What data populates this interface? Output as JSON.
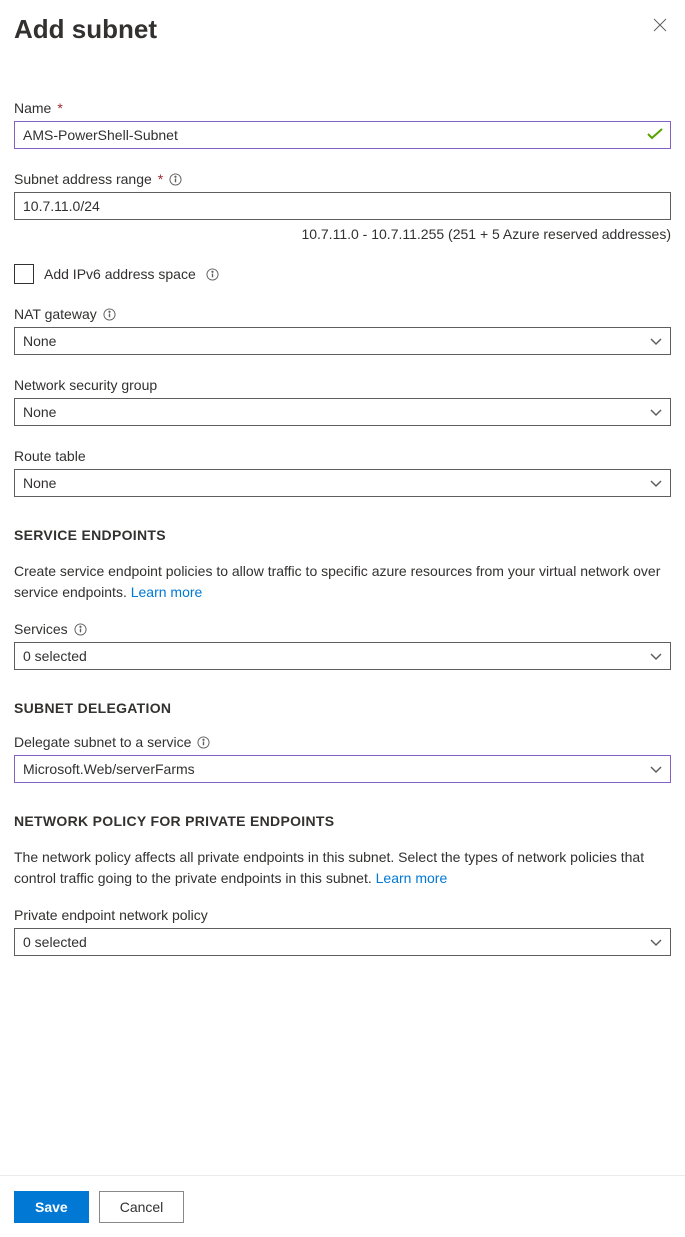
{
  "header": {
    "title": "Add subnet"
  },
  "fields": {
    "name": {
      "label": "Name",
      "value": "AMS-PowerShell-Subnet"
    },
    "address_range": {
      "label": "Subnet address range",
      "value": "10.7.11.0/24",
      "hint": "10.7.11.0 - 10.7.11.255 (251 + 5 Azure reserved addresses)"
    },
    "ipv6_checkbox": {
      "label": "Add IPv6 address space",
      "checked": false
    },
    "nat_gateway": {
      "label": "NAT gateway",
      "value": "None"
    },
    "nsg": {
      "label": "Network security group",
      "value": "None"
    },
    "route_table": {
      "label": "Route table",
      "value": "None"
    }
  },
  "service_endpoints": {
    "header": "SERVICE ENDPOINTS",
    "description": "Create service endpoint policies to allow traffic to specific azure resources from your virtual network over service endpoints. ",
    "learn_more": "Learn more",
    "services": {
      "label": "Services",
      "value": "0 selected"
    }
  },
  "delegation": {
    "header": "SUBNET DELEGATION",
    "label": "Delegate subnet to a service",
    "value": "Microsoft.Web/serverFarms"
  },
  "network_policy": {
    "header": "NETWORK POLICY FOR PRIVATE ENDPOINTS",
    "description": "The network policy affects all private endpoints in this subnet. Select the types of network policies that control traffic going to the private endpoints in this subnet. ",
    "learn_more": "Learn more",
    "label": "Private endpoint network policy",
    "value": "0 selected"
  },
  "footer": {
    "save": "Save",
    "cancel": "Cancel"
  }
}
